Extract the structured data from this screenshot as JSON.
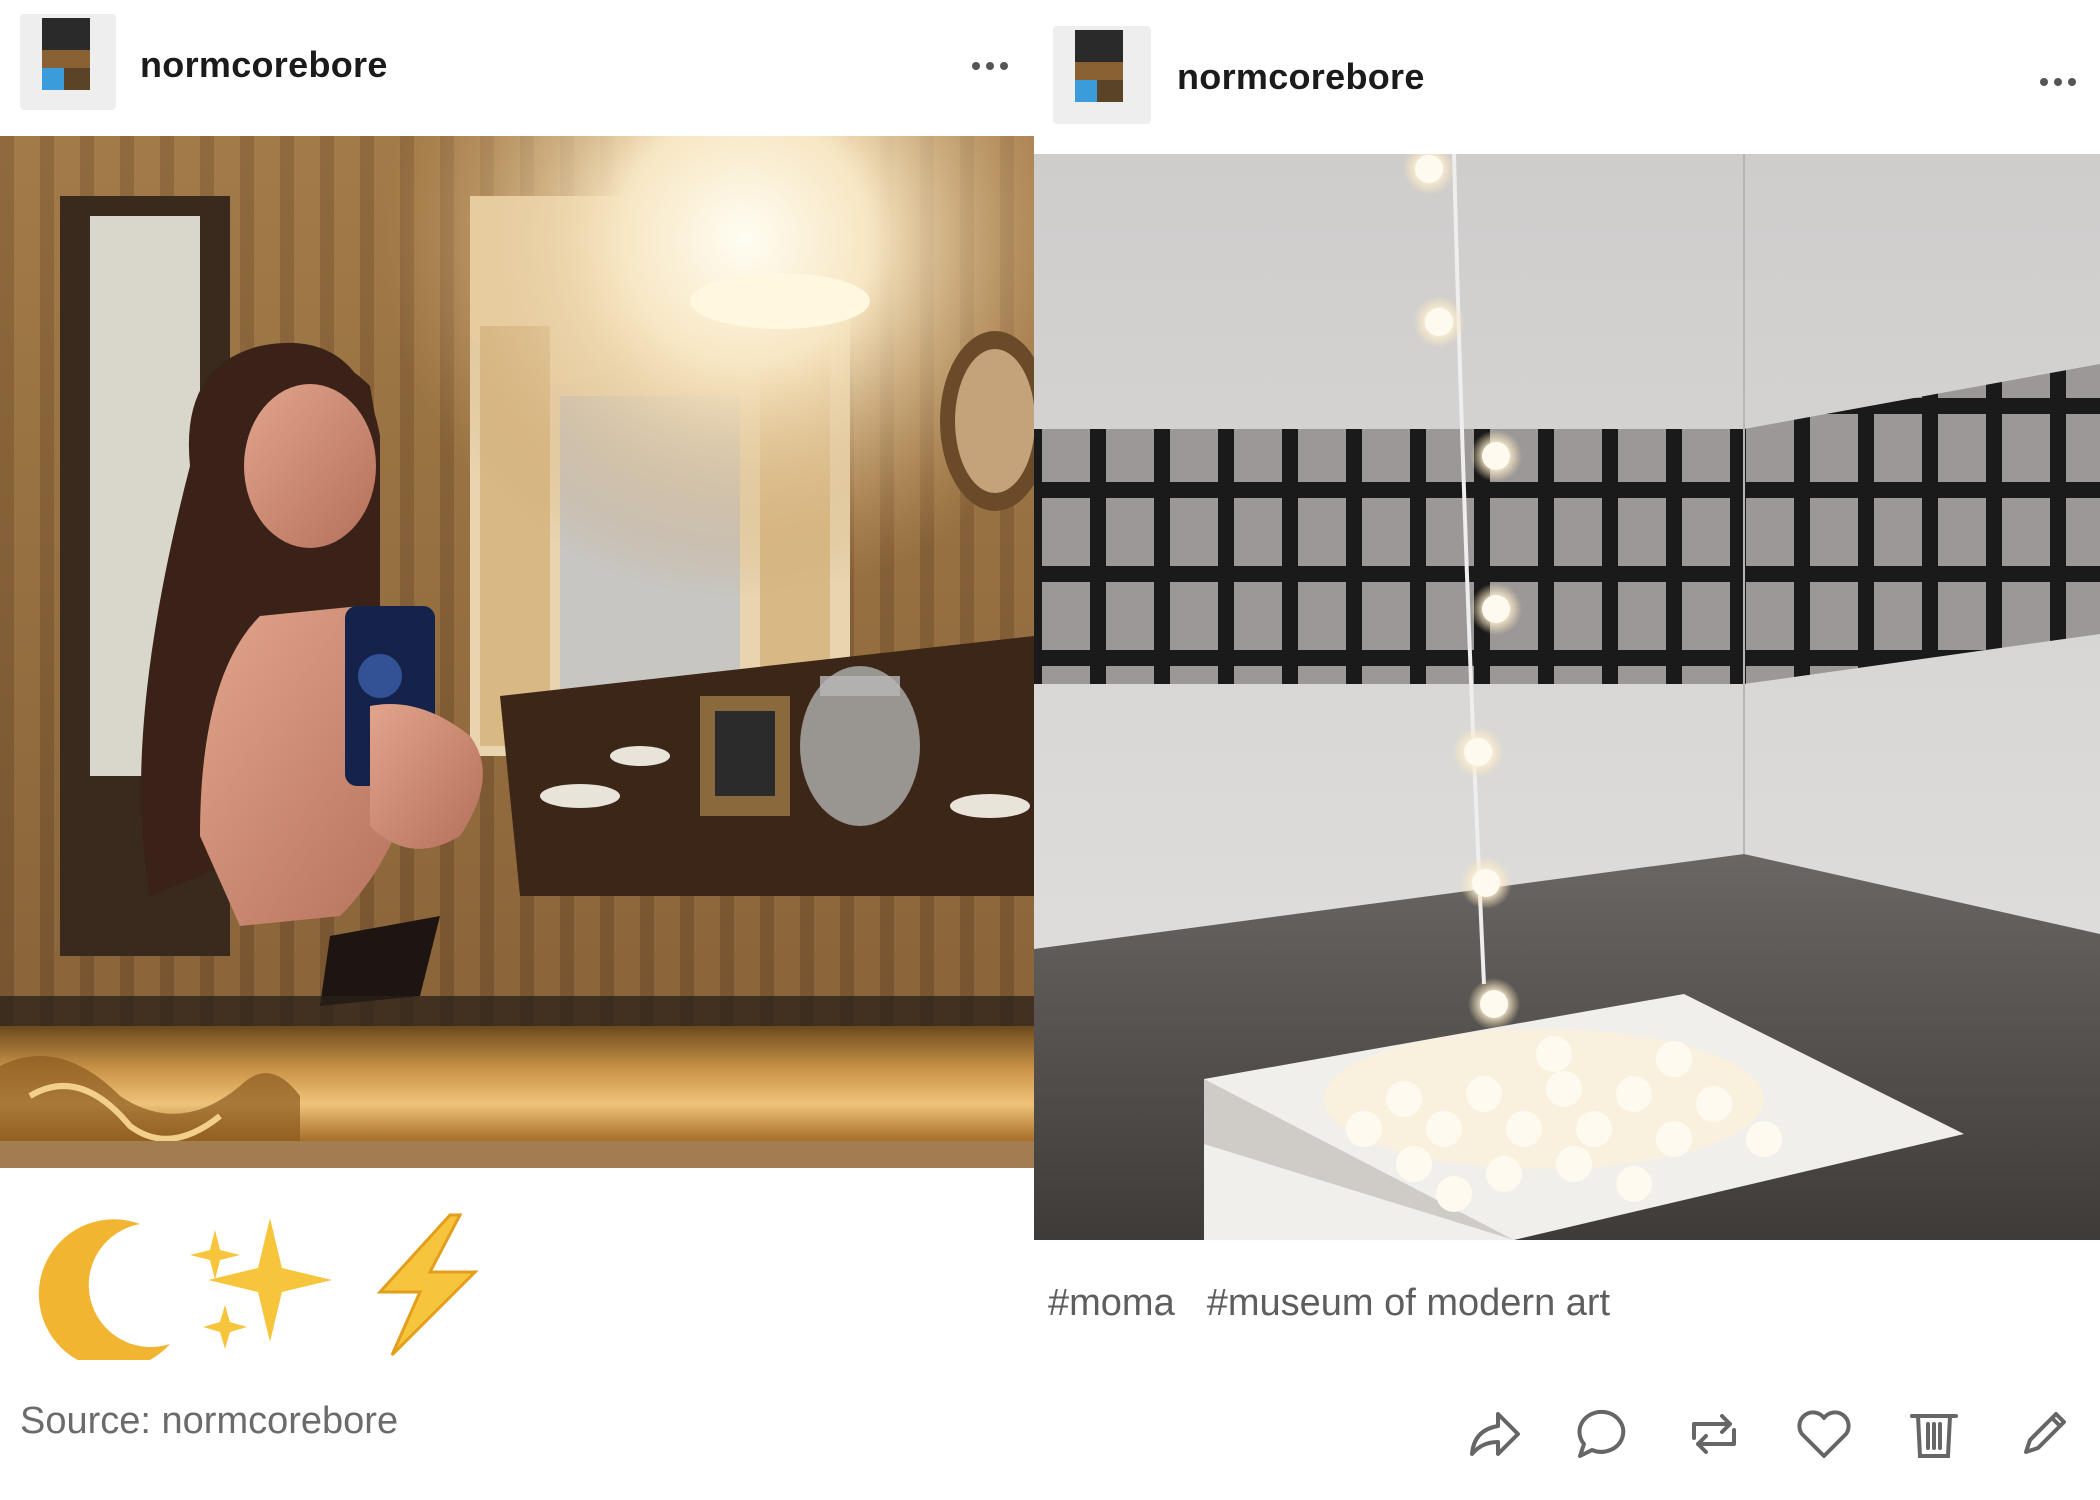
{
  "left_post": {
    "username": "normcorebore",
    "caption_icons": [
      "crescent-moon",
      "sparkles",
      "lightning-bolt"
    ],
    "source_label": "Source:",
    "source_name": "normcorebore"
  },
  "right_post": {
    "username": "normcorebore",
    "tags": [
      "#moma",
      "#museum of modern art"
    ],
    "actions": [
      "share-icon",
      "reply-icon",
      "reblog-icon",
      "like-icon",
      "delete-icon",
      "edit-icon"
    ]
  }
}
